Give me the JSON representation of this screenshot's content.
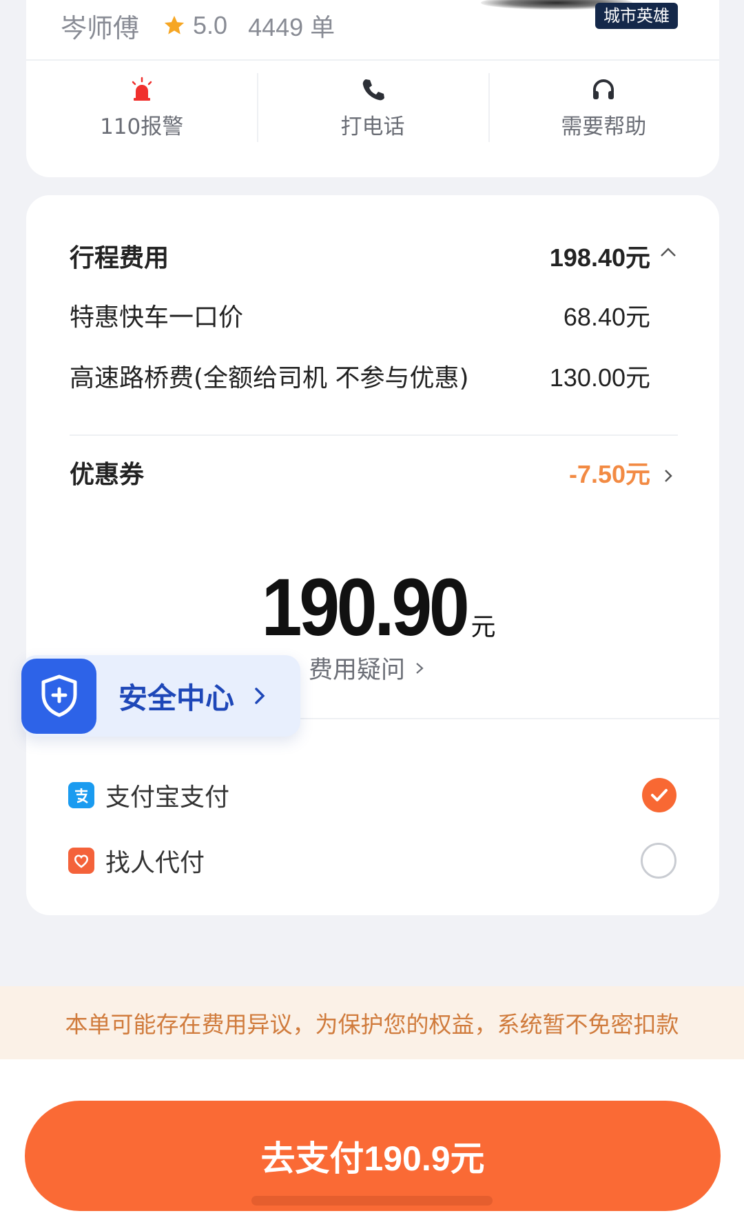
{
  "driver": {
    "name": "岑师傅",
    "rating": "5.0",
    "orders": "4449 单",
    "badge": "城市英雄"
  },
  "actions": [
    {
      "label": "110报警",
      "icon": "alarm-icon"
    },
    {
      "label": "打电话",
      "icon": "phone-icon"
    },
    {
      "label": "需要帮助",
      "icon": "headset-icon"
    }
  ],
  "fare": {
    "title": "行程费用",
    "total": "198.40元",
    "items": [
      {
        "label": "特惠快车一口价",
        "value": "68.40元"
      },
      {
        "label": "高速路桥费(全额给司机 不参与优惠)",
        "value": "130.00元"
      }
    ],
    "coupon_label": "优惠券",
    "coupon_value": "-7.50元",
    "amount": "190.90",
    "amount_unit": "元",
    "fee_question": "费用疑问"
  },
  "safety": {
    "label": "安全中心"
  },
  "payment_methods": [
    {
      "label": "支付宝支付",
      "icon": "alipay-icon",
      "selected": true
    },
    {
      "label": "找人代付",
      "icon": "proxy-pay-icon",
      "selected": false
    }
  ],
  "notice": "本单可能存在费用异议，为保护您的权益，系统暂不免密扣款",
  "pay_button": "去支付190.9元",
  "colors": {
    "accent": "#fa6a35",
    "coupon": "#f28a43",
    "safety": "#2d63e8",
    "notice_bg": "#fbf1e7",
    "notice_text": "#d07b3c"
  }
}
